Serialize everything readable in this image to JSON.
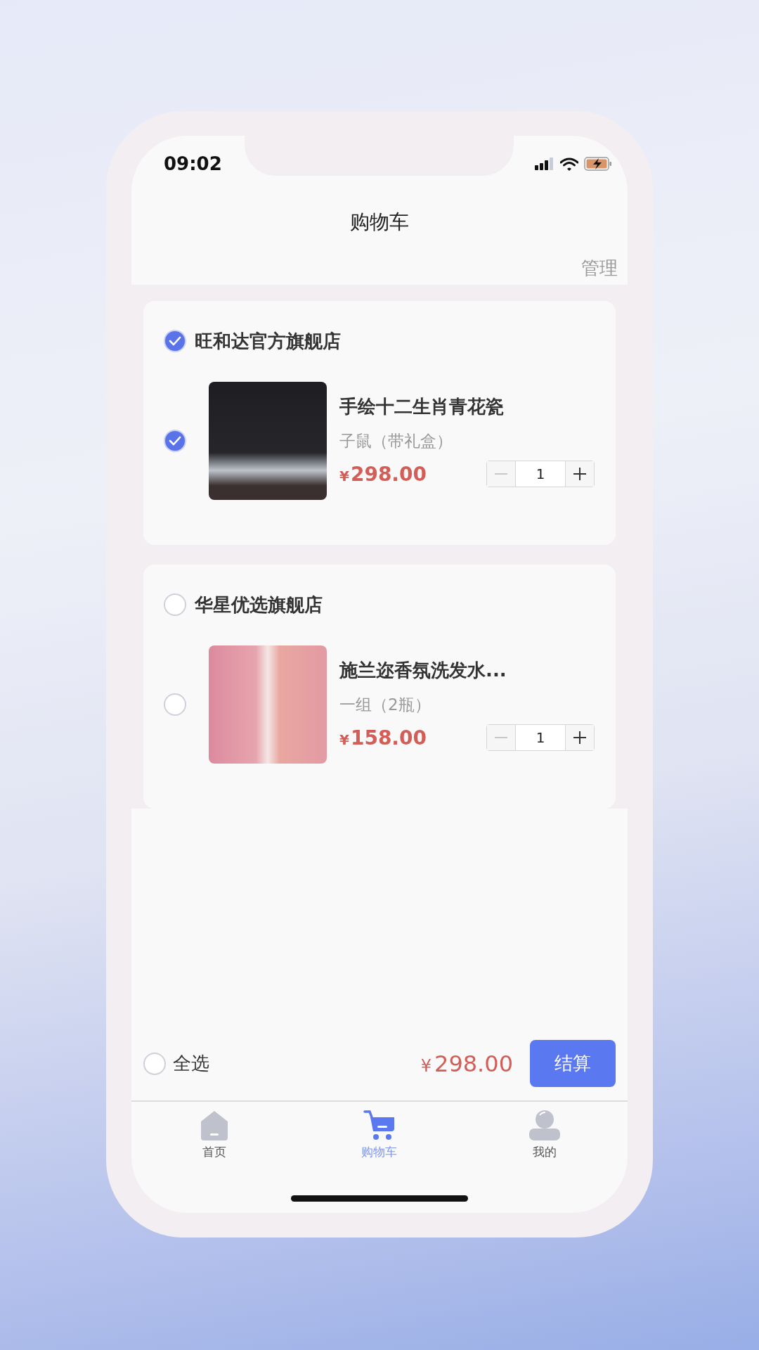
{
  "status_bar": {
    "time": "09:02"
  },
  "header": {
    "title": "购物车",
    "action": "管理"
  },
  "stores": [
    {
      "name": "旺和达官方旗舰店",
      "checked": true,
      "items": [
        {
          "title": "手绘十二生肖青花瓷",
          "variant": "子鼠（带礼盒）",
          "currency": "¥",
          "price": "298.00",
          "quantity": "1",
          "checked": true,
          "decrement_disabled": true
        }
      ]
    },
    {
      "name": "华星优选旗舰店",
      "checked": false,
      "items": [
        {
          "title": "施兰迩香氛洗发水...",
          "variant": "一组（2瓶）",
          "currency": "¥",
          "price": "158.00",
          "quantity": "1",
          "checked": false,
          "decrement_disabled": true
        }
      ]
    }
  ],
  "footer": {
    "select_all": {
      "label": "全选",
      "checked": false
    },
    "currency": "¥",
    "total": "298.00",
    "checkout": "结算"
  },
  "tab_bar": [
    {
      "kind": "home",
      "label": "首页",
      "selected": false
    },
    {
      "kind": "cart",
      "label": "购物车",
      "selected": true
    },
    {
      "kind": "profile",
      "label": "我的",
      "selected": false
    }
  ]
}
